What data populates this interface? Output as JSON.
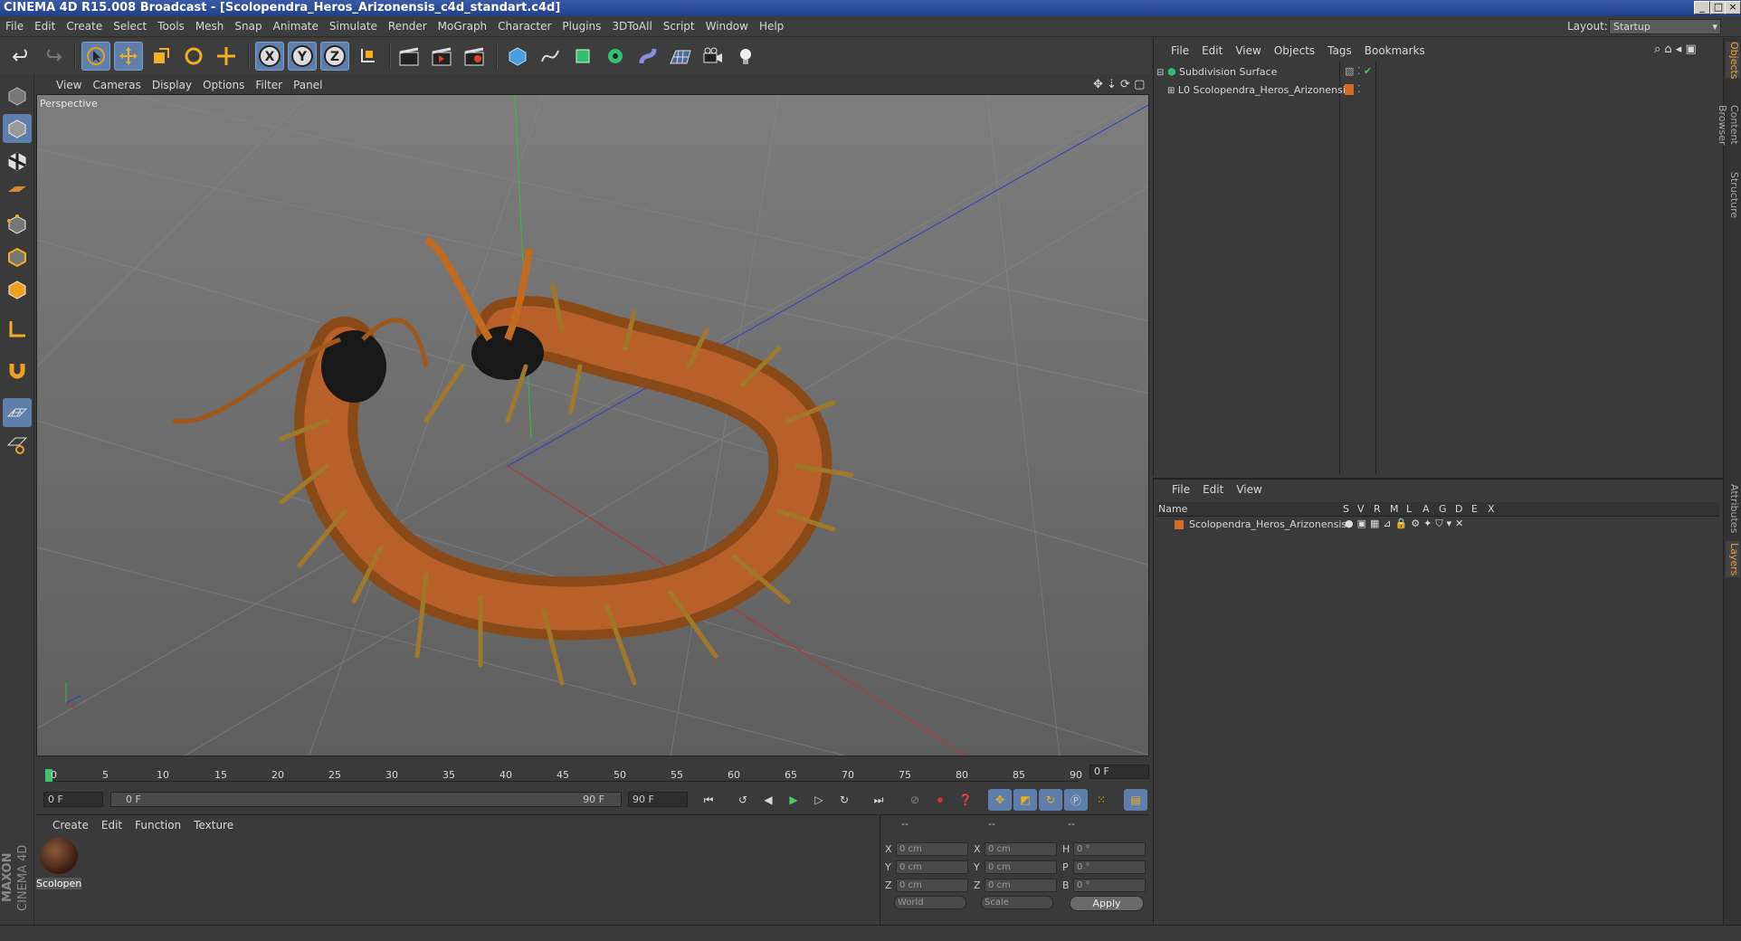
{
  "window": {
    "title": "CINEMA 4D R15.008 Broadcast - [Scolopendra_Heros_Arizonensis_c4d_standart.c4d]"
  },
  "menu": [
    "File",
    "Edit",
    "Create",
    "Select",
    "Tools",
    "Mesh",
    "Snap",
    "Animate",
    "Simulate",
    "Render",
    "MoGraph",
    "Character",
    "Plugins",
    "3DToAll",
    "Script",
    "Window",
    "Help"
  ],
  "layout": {
    "label": "Layout:",
    "value": "Startup"
  },
  "viewport": {
    "menu": [
      "View",
      "Cameras",
      "Display",
      "Options",
      "Filter",
      "Panel"
    ],
    "camera_label": "Perspective"
  },
  "timeline": {
    "ticks": [
      "0",
      "5",
      "10",
      "15",
      "20",
      "25",
      "30",
      "35",
      "40",
      "45",
      "50",
      "55",
      "60",
      "65",
      "70",
      "75",
      "80",
      "85",
      "90"
    ],
    "current_frame": "0 F",
    "start_field": "0 F",
    "range_start": "0 F",
    "range_end": "90 F",
    "end_field": "90 F"
  },
  "material_panel": {
    "menu": [
      "Create",
      "Edit",
      "Function",
      "Texture"
    ],
    "materials": [
      {
        "label": "Scolopen"
      }
    ]
  },
  "coordinates": {
    "header": [
      "--",
      "--",
      "--"
    ],
    "rows": [
      {
        "a": "X",
        "av": "0 cm",
        "b": "X",
        "bv": "0 cm",
        "c": "H",
        "cv": "0 °"
      },
      {
        "a": "Y",
        "av": "0 cm",
        "b": "Y",
        "bv": "0 cm",
        "c": "P",
        "cv": "0 °"
      },
      {
        "a": "Z",
        "av": "0 cm",
        "b": "Z",
        "bv": "0 cm",
        "c": "B",
        "cv": "0 °"
      }
    ],
    "space": "World",
    "mode": "Scale",
    "apply": "Apply"
  },
  "objects_panel": {
    "menu": [
      "File",
      "Edit",
      "View",
      "Objects",
      "Tags",
      "Bookmarks"
    ],
    "items": [
      {
        "name": "Subdivision Surface"
      },
      {
        "name": "Scolopendra_Heros_Arizonensis"
      }
    ]
  },
  "layers_panel": {
    "menu": [
      "File",
      "Edit",
      "View"
    ],
    "columns": [
      "Name",
      "S",
      "V",
      "R",
      "M",
      "L",
      "A",
      "G",
      "D",
      "E",
      "X"
    ],
    "items": [
      {
        "name": "Scolopendra_Heros_Arizonensis"
      }
    ]
  },
  "right_tabs": [
    "Objects",
    "Content Browser",
    "Structure",
    "Attributes",
    "Layers"
  ],
  "logo": {
    "brand": "MAXON",
    "product": "CINEMA 4D"
  },
  "colors": {
    "accent": "#5f7faa",
    "layer_color": "#d86a28",
    "active_tab": "#f0a030"
  }
}
